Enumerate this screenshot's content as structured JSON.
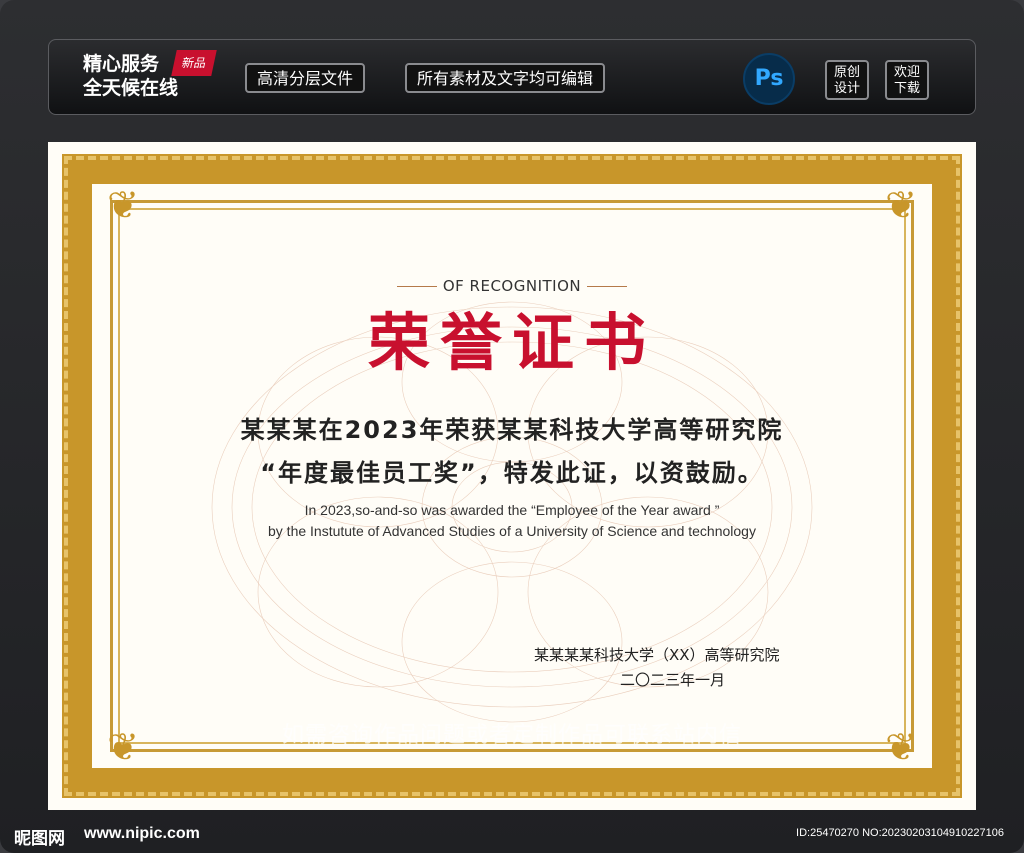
{
  "toolbar": {
    "brand_line1": "精心服务",
    "brand_line2": "全天候在线",
    "new_tag": "新品",
    "pill1": "高清分层文件",
    "pill2": "所有素材及文字均可编辑",
    "ps_label": "Ps",
    "btn_original_l1": "原创",
    "btn_original_l2": "设计",
    "btn_download_l1": "欢迎",
    "btn_download_l2": "下载"
  },
  "certificate": {
    "subtitle": "OF RECOGNITION",
    "title": "荣誉证书",
    "body_line1": "某某某在2023年荣获某某科技大学高等研究院",
    "body_line2": "“年度最佳员工奖”，特发此证，以资鼓励。",
    "en_line1": "In 2023,so-and-so was awarded the  “Employee of the Year award ”",
    "en_line2": "by the Instutute of Advanced Studies of a University of Science and technology",
    "issuer": "某某某某科技大学（XX）高等研究院",
    "date": "二〇二三年一月",
    "watermark": "如需咨询作品问题或者定制作品可联系站内信",
    "colors": {
      "title_red": "#c8102e",
      "gold": "#c8962a"
    }
  },
  "footer": {
    "site_logo": "昵图网",
    "site_url": "www.nipic.com",
    "image_id": "ID:25470270 NO:20230203104910227106"
  }
}
